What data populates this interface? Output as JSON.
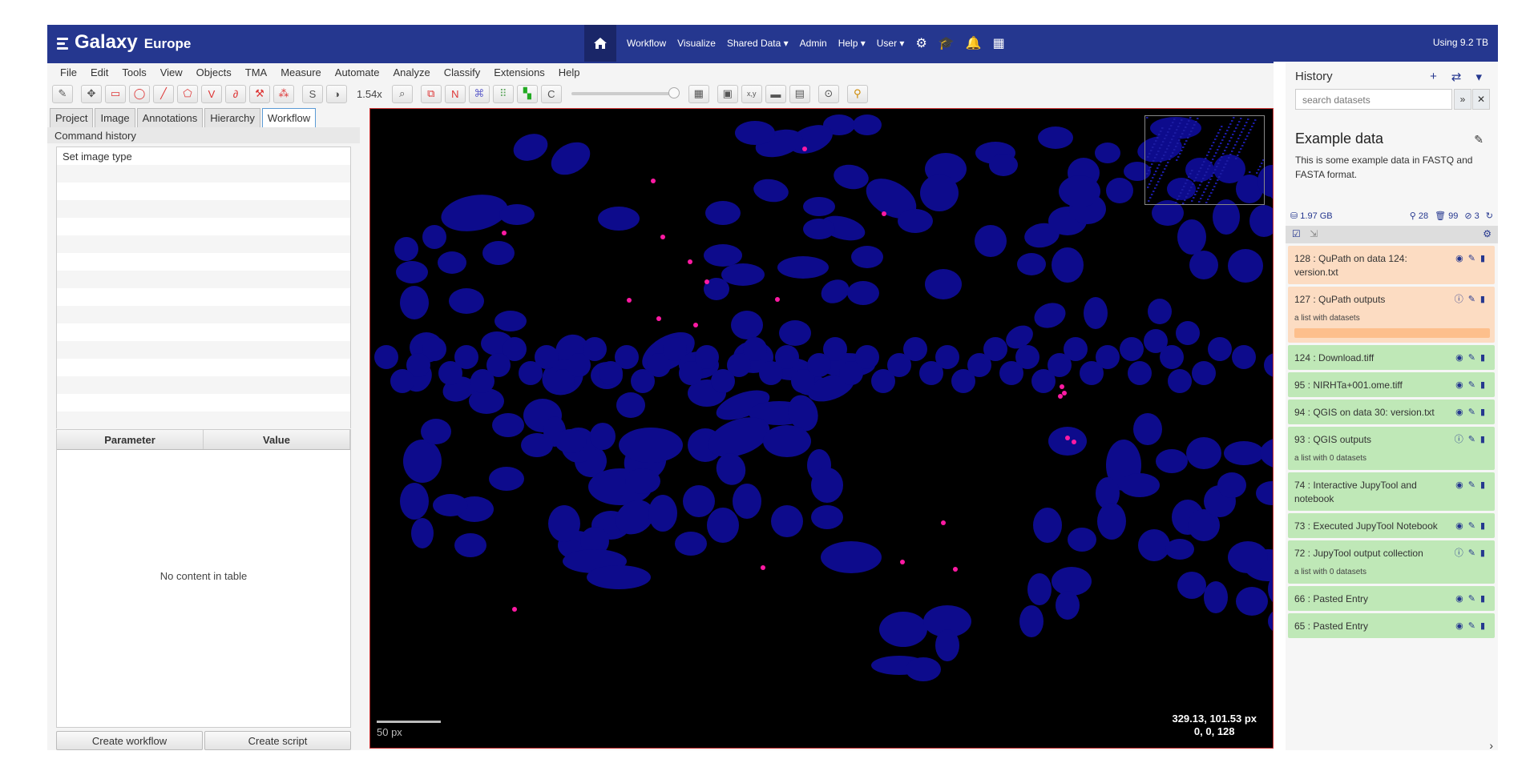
{
  "galaxy": {
    "brand": "Galaxy",
    "sub": "Europe",
    "quota": "Using 9.2 TB",
    "nav": [
      "Workflow",
      "Visualize",
      "Shared Data ▾",
      "Admin",
      "Help ▾",
      "User ▾"
    ]
  },
  "qupath": {
    "menus": [
      "File",
      "Edit",
      "Tools",
      "View",
      "Objects",
      "TMA",
      "Measure",
      "Automate",
      "Analyze",
      "Classify",
      "Extensions",
      "Help"
    ],
    "zoom": "1.54x",
    "tabs": [
      "Project",
      "Image",
      "Annotations",
      "Hierarchy",
      "Workflow"
    ],
    "command_history_label": "Command history",
    "commands": [
      "Set image type"
    ],
    "param_header": "Parameter",
    "value_header": "Value",
    "empty_table": "No content in table",
    "create_workflow": "Create workflow",
    "create_script": "Create script",
    "scale_label": "50 px",
    "coord_line1": "329.13, 101.53 px",
    "coord_line2": "0, 0, 128"
  },
  "history": {
    "title": "History",
    "search_placeholder": "search datasets",
    "name": "Example data",
    "annotation": "This is some example data in FASTQ and FASTA format.",
    "size": "1.97 GB",
    "shown": "28",
    "deleted": "99",
    "hidden": "3",
    "items": [
      {
        "text": "128 : QuPath on data 124: version.txt",
        "state": "q",
        "sub": ""
      },
      {
        "text": "127 : QuPath outputs",
        "state": "q",
        "sub": "a list with datasets",
        "prog": true
      },
      {
        "text": "124 : Download.tiff",
        "state": "ok",
        "sub": ""
      },
      {
        "text": "95 : NIRHTa+001.ome.tiff",
        "state": "ok",
        "sub": ""
      },
      {
        "text": "94 : QGIS on data 30: version.txt",
        "state": "ok",
        "sub": ""
      },
      {
        "text": "93 : QGIS outputs",
        "state": "ok",
        "sub": "a list with 0 datasets"
      },
      {
        "text": "74 : Interactive JupyTool and notebook",
        "state": "ok",
        "sub": ""
      },
      {
        "text": "73 : Executed JupyTool Notebook",
        "state": "ok",
        "sub": ""
      },
      {
        "text": "72 : JupyTool output collection",
        "state": "ok",
        "sub": "a list with 0 datasets"
      },
      {
        "text": "66 : Pasted Entry",
        "state": "ok",
        "sub": ""
      },
      {
        "text": "65 : Pasted Entry",
        "state": "ok",
        "sub": ""
      }
    ]
  }
}
